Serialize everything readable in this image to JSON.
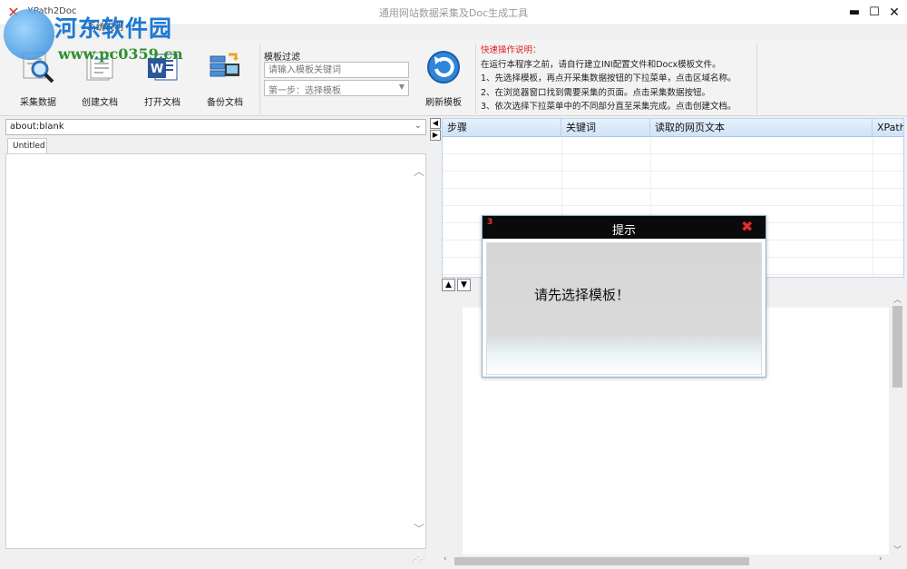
{
  "window": {
    "app_name": "XPath2Doc",
    "title": "通用网站数据采集及Doc生成工具",
    "min": "▬",
    "max": "☐",
    "close": "✕",
    "menu_text": "系统说明"
  },
  "watermark": {
    "title": "河东软件园",
    "url": "www.pc0359.cn"
  },
  "toolbar": {
    "collect": "采集数据",
    "create": "创建文档",
    "open": "打开文档",
    "backup": "备份文档",
    "refresh": "刷新模板"
  },
  "filter": {
    "label": "模板过滤",
    "placeholder": "请输入模板关键词",
    "select_value": "第一步：选择模板"
  },
  "help": {
    "title": "快速操作说明：",
    "lines": [
      "在运行本程序之前，请自行建立INI配置文件和Docx模板文件。",
      "1、先选择模板，再点开采集数据按钮的下拉菜单，点击区域名称。",
      "2、在浏览器窗口找到需要采集的页面。点击采集数据按钮。",
      "3、依次选择下拉菜单中的不同部分直至采集完成。点击创建文档。"
    ]
  },
  "browser": {
    "address": "about:blank",
    "tab": "Untitled"
  },
  "grid": {
    "columns": [
      "步骤",
      "关键词",
      "读取的网页文本",
      "XPath"
    ]
  },
  "dialog": {
    "number": "3",
    "title": "提示",
    "message": "请先选择模板！",
    "close": "✖"
  },
  "colors": {
    "help_title": "#e02020",
    "dialog_header": "#0a0a0a",
    "dialog_close": "#e62a2a"
  }
}
